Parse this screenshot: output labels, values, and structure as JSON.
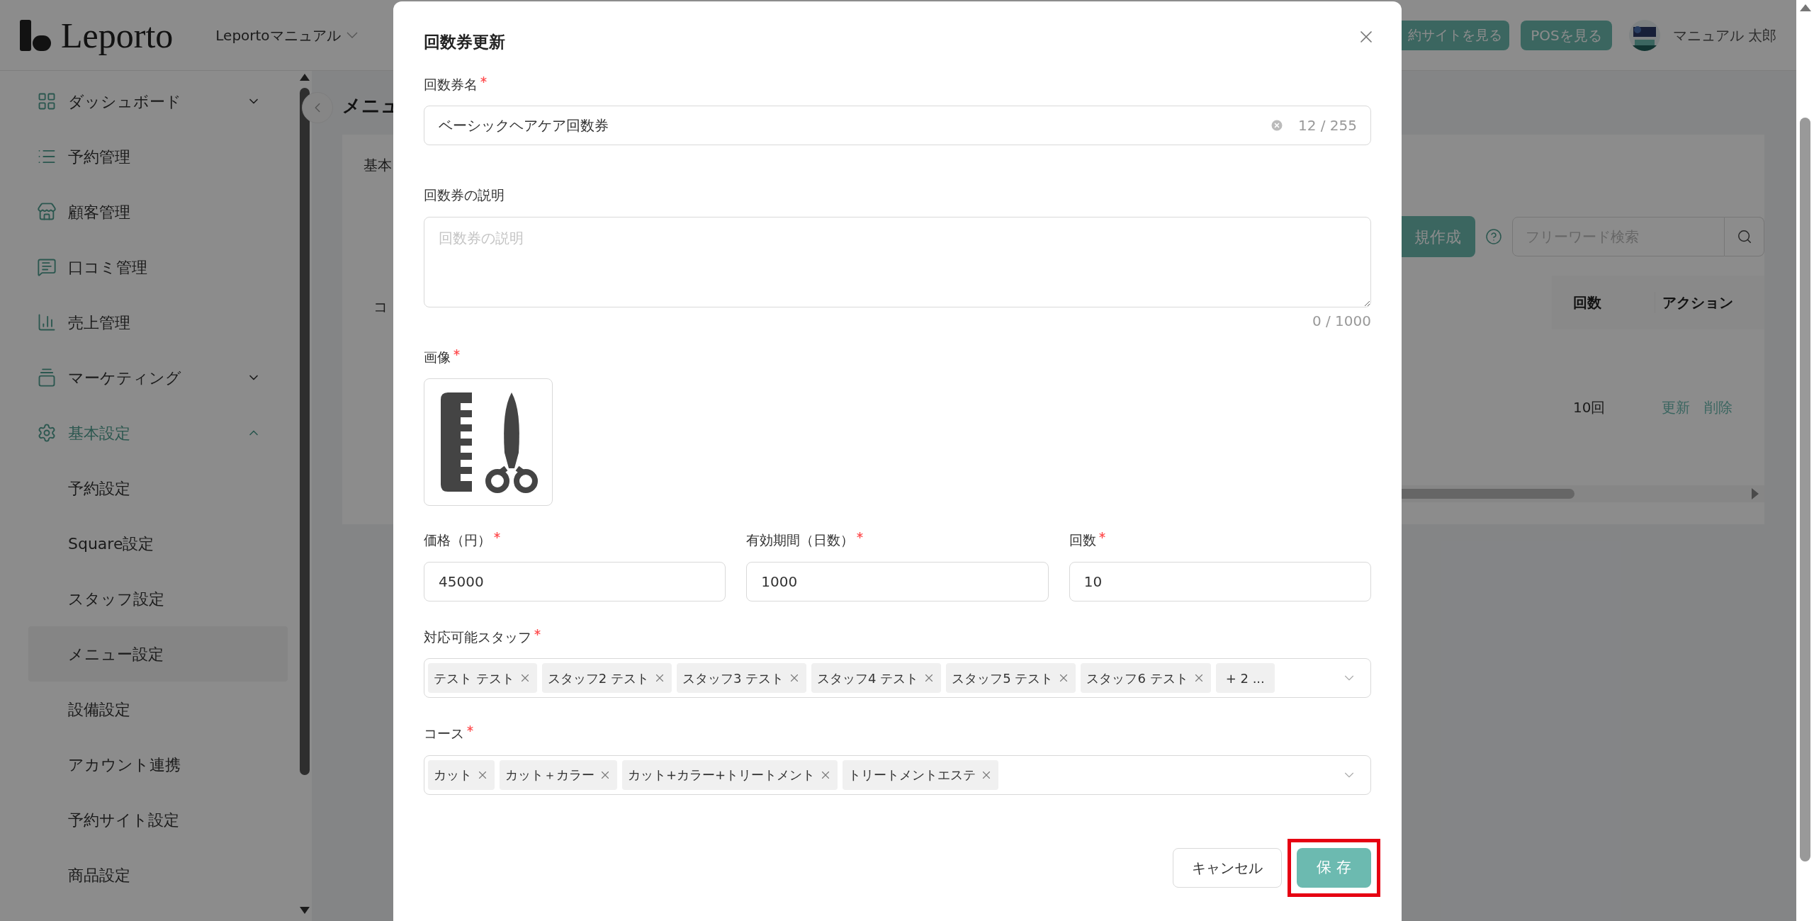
{
  "header": {
    "logo": "Leporto",
    "store_selector": "Leportoマニュアル",
    "buttons": [
      "約サイトを見る",
      "POSを見る"
    ],
    "user_name": "マニュアル 太郎"
  },
  "sidebar": {
    "items": [
      {
        "label": "ダッシュボード",
        "kind": "group",
        "expanded": false,
        "selected": false
      },
      {
        "label": "予約管理",
        "kind": "link",
        "selected": false
      },
      {
        "label": "顧客管理",
        "kind": "link",
        "selected": false
      },
      {
        "label": "口コミ管理",
        "kind": "link",
        "selected": false
      },
      {
        "label": "売上管理",
        "kind": "link",
        "selected": false
      },
      {
        "label": "マーケティング",
        "kind": "group",
        "expanded": false,
        "selected": false
      },
      {
        "label": "基本設定",
        "kind": "group",
        "expanded": true,
        "selected": true,
        "children": [
          {
            "label": "予約設定",
            "selected": false
          },
          {
            "label": "Square設定",
            "selected": false
          },
          {
            "label": "スタッフ設定",
            "selected": false
          },
          {
            "label": "メニュー設定",
            "selected": true
          },
          {
            "label": "設備設定",
            "selected": false
          },
          {
            "label": "アカウント連携",
            "selected": false
          },
          {
            "label": "予約サイト設定",
            "selected": false
          },
          {
            "label": "商品設定",
            "selected": false
          }
        ]
      }
    ]
  },
  "main": {
    "page_title": "メニュ",
    "tab": "基本",
    "create_button": "規作成",
    "search_placeholder": "フリーワード検索",
    "table": {
      "columns": [
        "コ",
        "回数",
        "アクション"
      ],
      "rows": [
        {
          "count": "10回",
          "actions": [
            "更新",
            "削除"
          ]
        }
      ]
    }
  },
  "modal": {
    "title": "回数券更新",
    "name_field": {
      "label": "回数券名",
      "required": true,
      "value": "ベーシックヘアケア回数券",
      "counter": "12 / 255"
    },
    "description_field": {
      "label": "回数券の説明",
      "placeholder": "回数券の説明",
      "counter": "0 / 1000"
    },
    "image_field": {
      "label": "画像",
      "required": true
    },
    "number_fields": [
      {
        "label": "価格（円）",
        "required": true,
        "value": "45000"
      },
      {
        "label": "有効期間（日数）",
        "required": true,
        "value": "1000"
      },
      {
        "label": "回数",
        "required": true,
        "value": "10"
      }
    ],
    "staff_field": {
      "label": "対応可能スタッフ",
      "required": true,
      "tags": [
        {
          "label": "テスト テスト",
          "kind": "tag"
        },
        {
          "label": "スタッフ2 テスト",
          "kind": "tag"
        },
        {
          "label": "スタッフ3 テスト",
          "kind": "tag"
        },
        {
          "label": "スタッフ4 テスト",
          "kind": "tag"
        },
        {
          "label": "スタッフ5 テスト",
          "kind": "tag"
        },
        {
          "label": "スタッフ6 テスト",
          "kind": "tag"
        },
        {
          "label": "+ 2 ...",
          "kind": "more"
        }
      ]
    },
    "course_field": {
      "label": "コース",
      "required": true,
      "tags": [
        {
          "label": "カット",
          "kind": "tag"
        },
        {
          "label": "カット＋カラー",
          "kind": "tag"
        },
        {
          "label": "カット+カラー+トリートメント",
          "kind": "tag"
        },
        {
          "label": "トリートメントエステ",
          "kind": "tag"
        }
      ]
    },
    "cancel_button": {
      "label": "キャンセル"
    },
    "save_button": {
      "label": "保 存",
      "highlighted": true
    }
  }
}
